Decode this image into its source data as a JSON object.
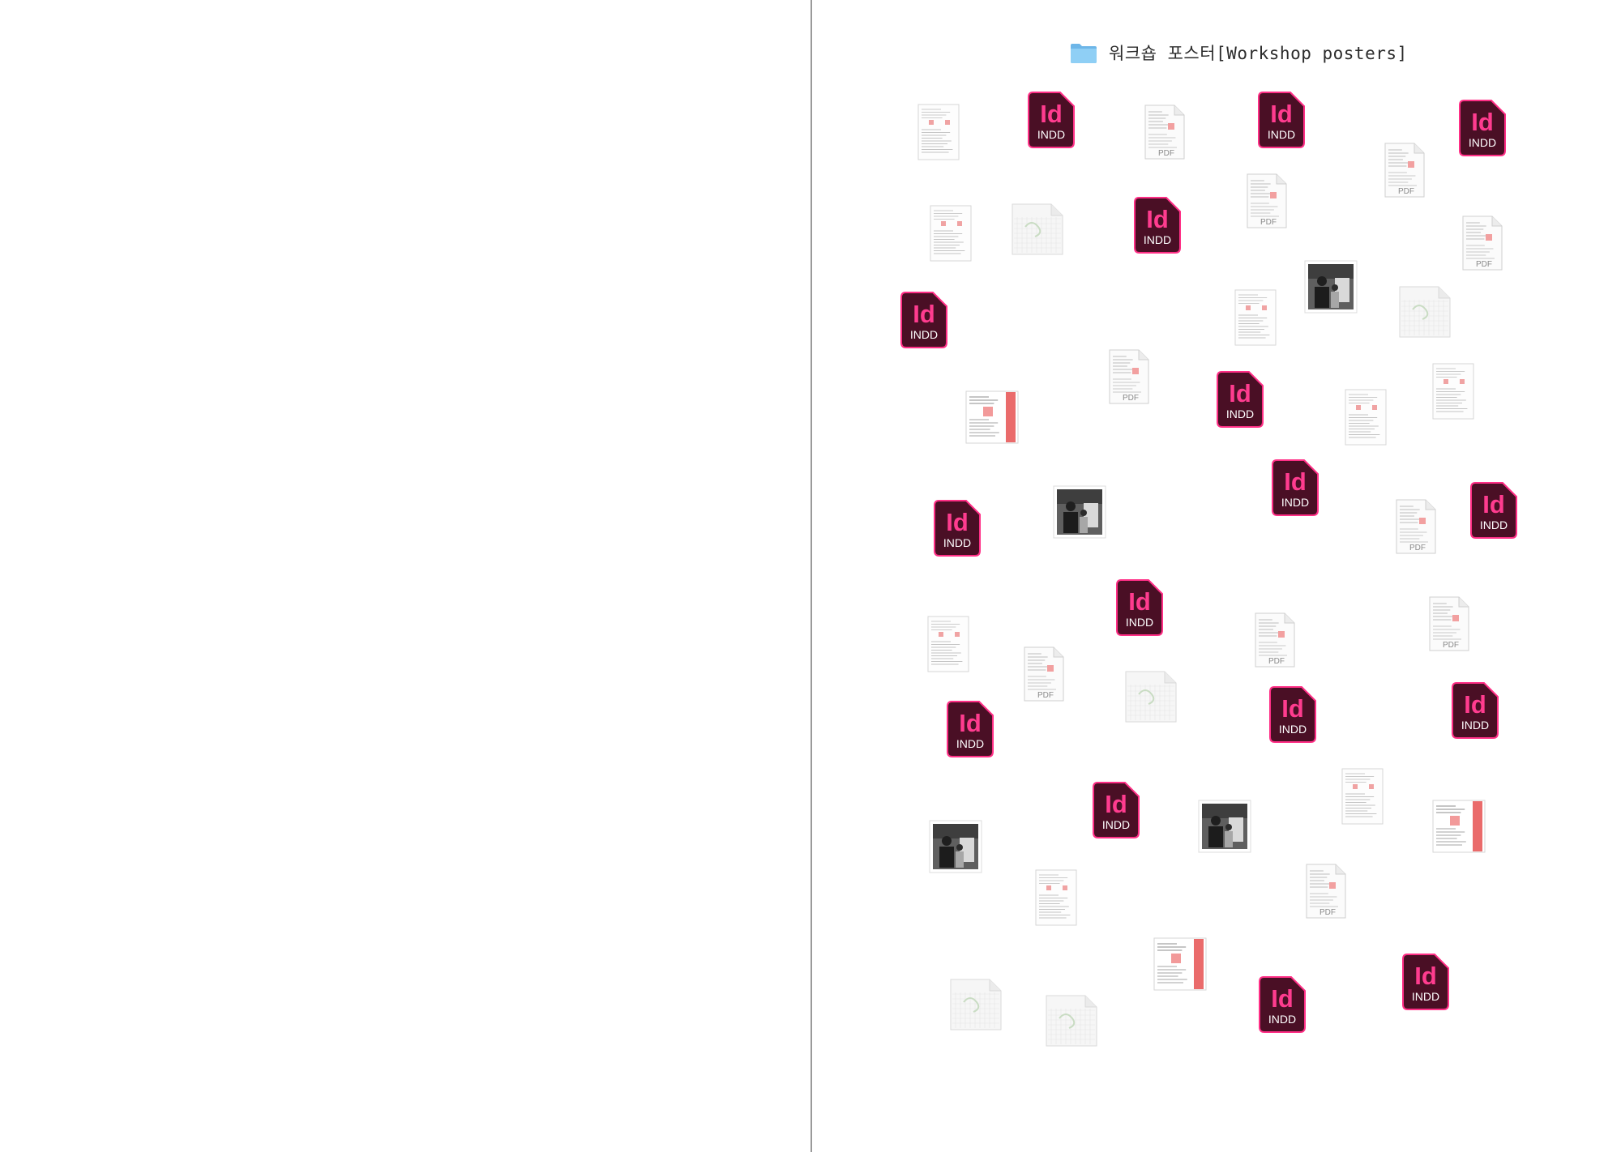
{
  "folder": {
    "title": "워크숍 포스터[Workshop posters]",
    "icon": "folder-icon",
    "color": "#7ec3f0"
  },
  "file_types": {
    "indd": {
      "icon": "indesign-file-icon",
      "app_label": "Id",
      "ext_label": "INDD",
      "colors": {
        "background": "#4a0f25",
        "accent": "#ff3c8f",
        "border": "#ff2f86"
      }
    },
    "pdf": {
      "icon": "pdf-file-icon",
      "ext_label": "PDF"
    },
    "doc": {
      "icon": "document-thumbnail-icon"
    },
    "photo": {
      "icon": "photo-thumbnail-icon"
    },
    "blank": {
      "icon": "blank-file-icon"
    },
    "red_doc": {
      "icon": "red-document-thumbnail-icon"
    }
  },
  "files": [
    {
      "type": "doc"
    },
    {
      "type": "indd"
    },
    {
      "type": "pdf"
    },
    {
      "type": "indd"
    },
    {
      "type": "indd"
    },
    {
      "type": "doc"
    },
    {
      "type": "blank"
    },
    {
      "type": "indd"
    },
    {
      "type": "pdf"
    },
    {
      "type": "pdf"
    },
    {
      "type": "pdf"
    },
    {
      "type": "indd"
    },
    {
      "type": "doc"
    },
    {
      "type": "photo"
    },
    {
      "type": "blank"
    },
    {
      "type": "red_doc"
    },
    {
      "type": "pdf"
    },
    {
      "type": "indd"
    },
    {
      "type": "doc"
    },
    {
      "type": "doc"
    },
    {
      "type": "indd"
    },
    {
      "type": "photo"
    },
    {
      "type": "indd"
    },
    {
      "type": "pdf"
    },
    {
      "type": "indd"
    },
    {
      "type": "doc"
    },
    {
      "type": "indd"
    },
    {
      "type": "pdf"
    },
    {
      "type": "pdf"
    },
    {
      "type": "pdf"
    },
    {
      "type": "blank"
    },
    {
      "type": "indd"
    },
    {
      "type": "indd"
    },
    {
      "type": "indd"
    },
    {
      "type": "photo"
    },
    {
      "type": "indd"
    },
    {
      "type": "photo"
    },
    {
      "type": "doc"
    },
    {
      "type": "red_doc"
    },
    {
      "type": "doc"
    },
    {
      "type": "pdf"
    },
    {
      "type": "red_doc"
    },
    {
      "type": "blank"
    },
    {
      "type": "indd"
    },
    {
      "type": "blank"
    },
    {
      "type": "indd"
    }
  ]
}
